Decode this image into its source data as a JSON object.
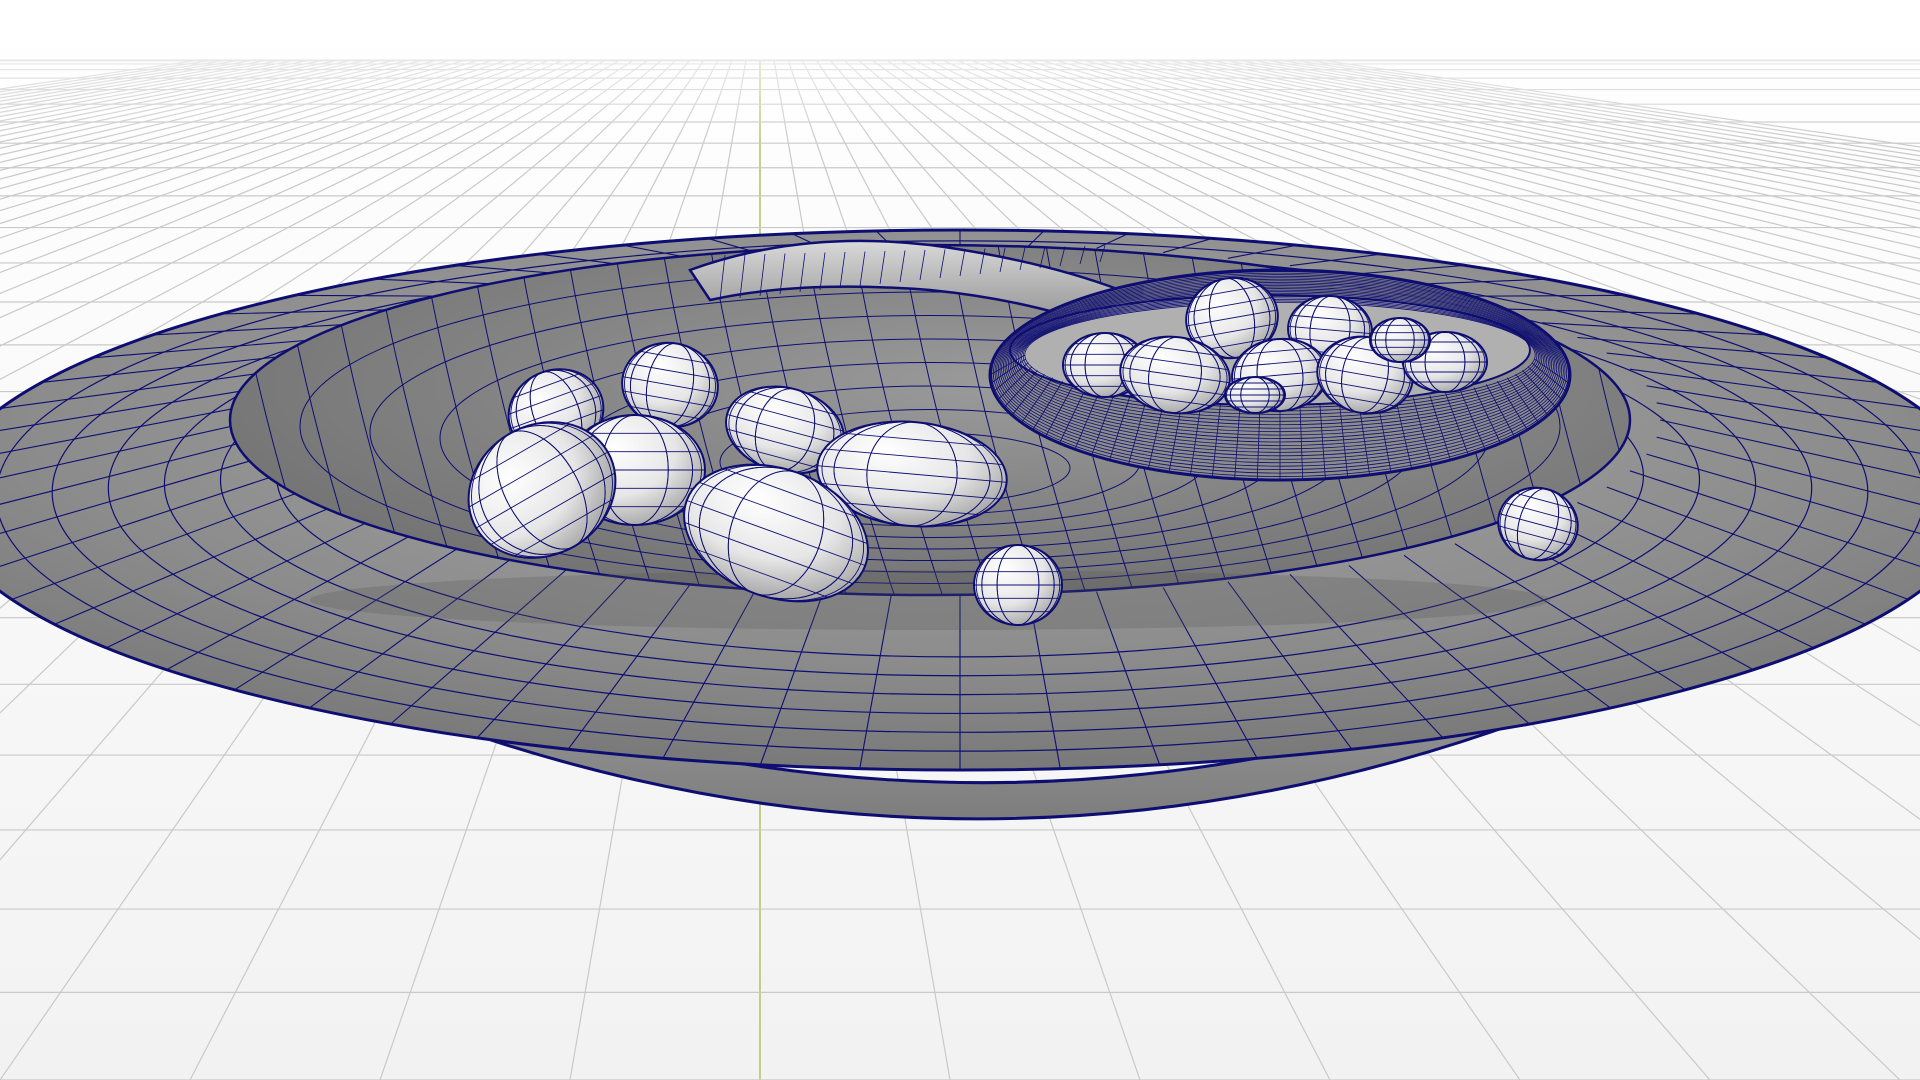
{
  "viewport": {
    "background_top": "#ffffff",
    "background_bottom": "#f4f4f4",
    "grid_color": "#c9c9c9",
    "axis_color": "#b5c66a",
    "wire_color": "#0e0e72",
    "surface_color": "#8a8a8a",
    "surface_highlight": "#b8b8b8",
    "pivot_color": "#e0a43a"
  },
  "objects": [
    {
      "name": "plate",
      "kind": "mesh"
    },
    {
      "name": "spoon",
      "kind": "mesh"
    },
    {
      "name": "nut",
      "kind": "mesh",
      "count": 17
    }
  ]
}
